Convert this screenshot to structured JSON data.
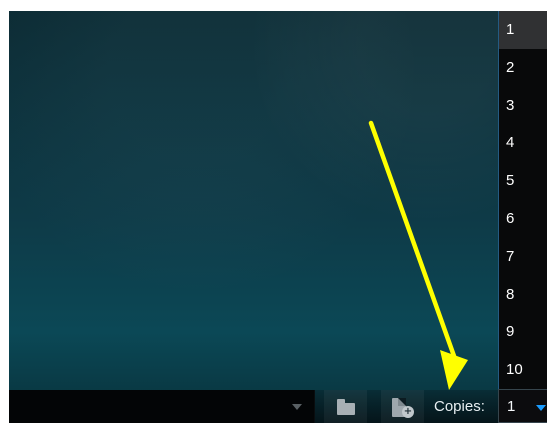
{
  "bottom_bar": {
    "copies_label": "Copies:",
    "copies_value": "1",
    "folder_icon": "folder-icon",
    "add_file_icon": "add-file-icon",
    "dropdown_caret_icon": "caret-down-icon"
  },
  "copies_dropdown": {
    "options": [
      "1",
      "2",
      "3",
      "4",
      "5",
      "6",
      "7",
      "8",
      "9",
      "10"
    ],
    "selected_value": "1"
  },
  "annotation": {
    "arrow_icon": "arrow-icon",
    "arrow_color": "#ffff00"
  },
  "colors": {
    "background": "#0e3a47",
    "dropdown_border": "#245b83",
    "caret_accent": "#1a9cff"
  }
}
